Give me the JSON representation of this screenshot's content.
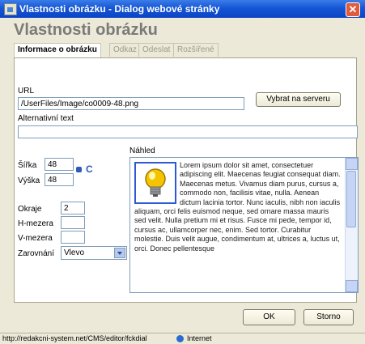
{
  "window": {
    "title": "Vlastnosti obrázku - Dialog webové stránky",
    "close_glyph": "✕"
  },
  "heading": "Vlastnosti obrázku",
  "tabs": [
    {
      "label": "Informace o obrázku",
      "active": true
    },
    {
      "label": "Odkaz",
      "active": false
    },
    {
      "label": "Odeslat",
      "active": false
    },
    {
      "label": "Rozšířené",
      "active": false
    }
  ],
  "url": {
    "label": "URL",
    "value": "/UserFiles/Image/co0009-48.png",
    "browse_button": "Vybrat na serveru"
  },
  "alt": {
    "label": "Alternativní text",
    "value": ""
  },
  "size": {
    "width_label": "Šířka",
    "width_value": "48",
    "height_label": "Výška",
    "height_value": "48",
    "lock_icon": "lock-icon",
    "reset_icon": "reset-size-icon",
    "reset_glyph": "C"
  },
  "border": {
    "label": "Okraje",
    "value": "2"
  },
  "hspace": {
    "label": "H-mezera",
    "value": ""
  },
  "vspace": {
    "label": "V-mezera",
    "value": ""
  },
  "align": {
    "label": "Zarovnání",
    "value": "Vlevo"
  },
  "preview": {
    "label": "Náhled",
    "text": "Lorem ipsum dolor sit amet, consectetuer adipiscing elit. Maecenas feugiat consequat diam. Maecenas metus. Vivamus diam purus, cursus a, commodo non, facilisis vitae, nulla. Aenean dictum lacinia tortor. Nunc iaculis, nibh non iaculis aliquam, orci felis euismod neque, sed ornare massa mauris sed velit. Nulla pretium mi et risus. Fusce mi pede, tempor id, cursus ac, ullamcorper nec, enim. Sed tortor. Curabitur molestie. Duis velit augue, condimentum at, ultrices a, luctus ut, orci. Donec pellentesque"
  },
  "buttons": {
    "ok": "OK",
    "cancel": "Storno"
  },
  "status": {
    "url": "http://redakcni-system.net/CMS/editor/fckdial",
    "zone": "Internet"
  },
  "colors": {
    "titlebar": "#0a44c4",
    "accent": "#2d5ad4",
    "bulb": "#f5c400"
  }
}
